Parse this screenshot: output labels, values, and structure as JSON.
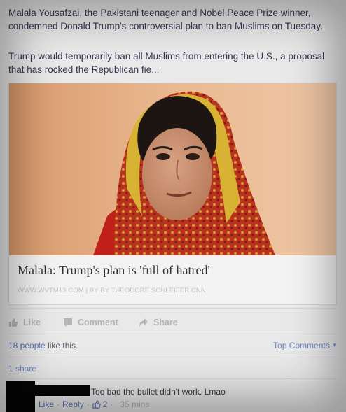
{
  "post": {
    "text_1": "Malala Yousafzai, the Pakistani teenager and Nobel Peace Prize winner, condemned Donald Trump's controversial plan to ban Muslims on Tuesday.",
    "text_2": "Trump would temporarily ban all Muslims from entering the U.S., a proposal that has rocked the Republican fie..."
  },
  "link": {
    "title": "Malala: Trump's plan is 'full of hatred'",
    "source": "WWW.WVTM13.COM | BY BY THEODORE SCHLEIFER CNN"
  },
  "actions": {
    "like": "Like",
    "comment": "Comment",
    "share": "Share"
  },
  "likes": {
    "people": "18 people",
    "suffix": " like this."
  },
  "top_comments": "Top Comments",
  "shares": "1 share",
  "comment": {
    "text": "Too bad the bullet didn't work. Lmao",
    "like": "Like",
    "reply": "Reply",
    "like_count": "2",
    "time": "35 mins"
  },
  "icons": {
    "like": "thumbs-up-icon",
    "comment": "comment-bubble-icon",
    "share": "share-arrow-icon",
    "dropdown": "caret-down-icon"
  },
  "colors": {
    "link_blue": "#5a72b4",
    "muted": "#b4b4bb"
  }
}
